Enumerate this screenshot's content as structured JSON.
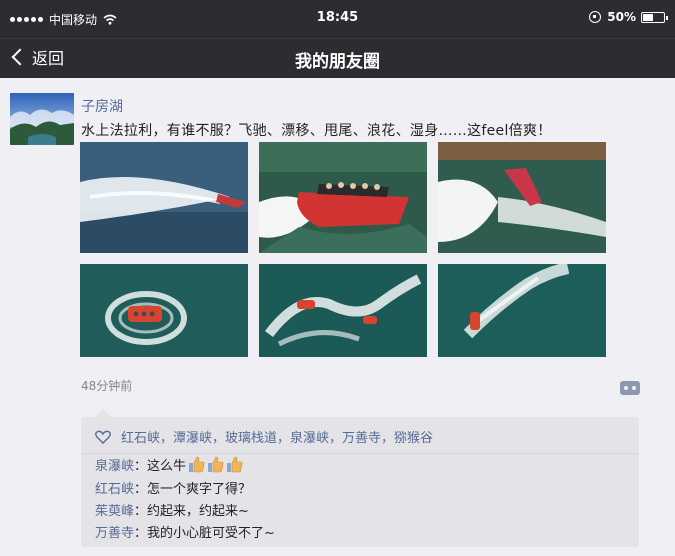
{
  "status_bar": {
    "carrier": "中国移动",
    "time": "18:45",
    "battery": "50%",
    "battery_level": 0.5,
    "icons": [
      "signal-dots-icon",
      "wifi-icon",
      "rotation-lock-icon",
      "battery-icon"
    ]
  },
  "nav": {
    "back_label": "返回",
    "title": "我的朋友圈"
  },
  "post": {
    "author": "子房湖",
    "text": "水上法拉利，有谁不服？飞驰、漂移、甩尾、浪花、湿身……这feel倍爽！",
    "time": "48分钟前",
    "photos": [
      "speedboat-spray-photo",
      "red-jetboat-passengers-photo",
      "jetboat-splash-photo",
      "aerial-jetboat-circle-photo",
      "aerial-two-jetboats-photo",
      "aerial-jetboat-wake-photo"
    ]
  },
  "likes": {
    "text": "红石峡，潭瀑峡，玻璃栈道，泉瀑峡，万善寺，猕猴谷"
  },
  "comments": [
    {
      "name": "泉瀑峡",
      "sep": "：",
      "text": "这么牛",
      "emoji": [
        "thumbs-up-icon",
        "thumbs-up-icon",
        "thumbs-up-icon"
      ]
    },
    {
      "name": "红石峡",
      "sep": "：",
      "text": "怎一个爽字了得？"
    },
    {
      "name": "茱萸峰",
      "sep": "：",
      "text": "约起来，约起来~"
    },
    {
      "name": "万善寺",
      "sep": "：",
      "text": "我的小心脏可受不了~"
    }
  ],
  "colors": {
    "bar_bg": "#2d2c31",
    "page_bg": "#efeff4",
    "link": "#576b95",
    "comment_bg": "#e4e4e8"
  }
}
